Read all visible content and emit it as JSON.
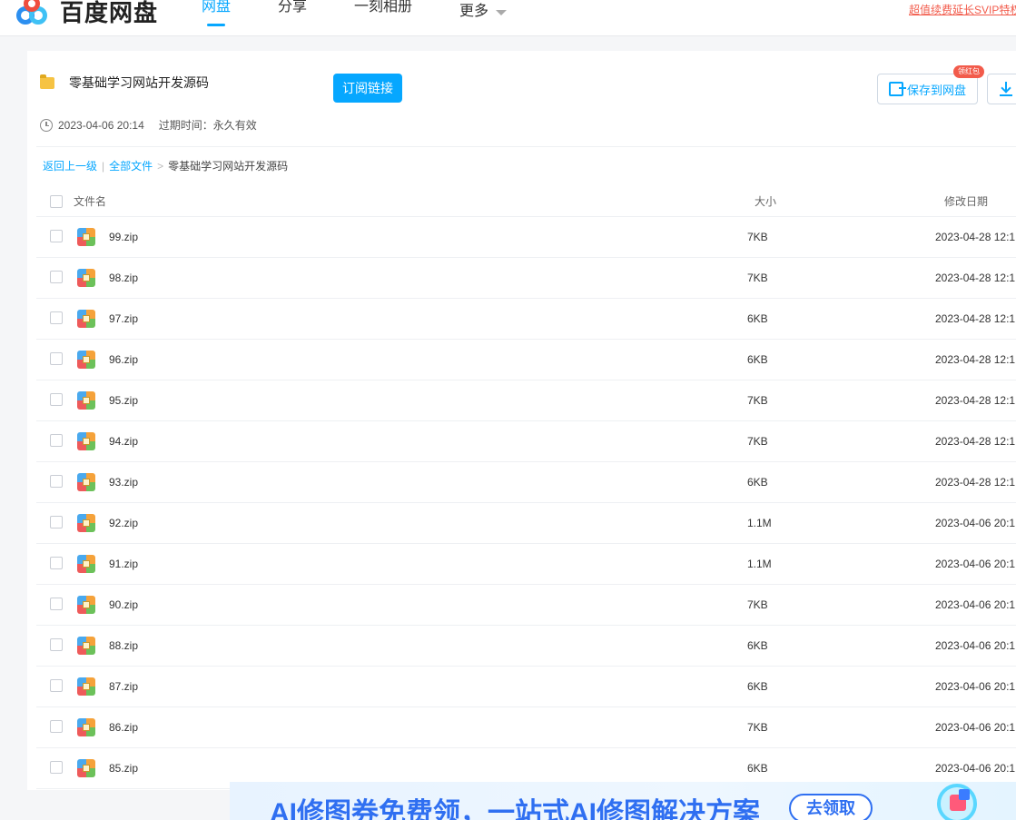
{
  "app": {
    "logo_text": "百度网盘"
  },
  "nav": {
    "items": [
      {
        "label": "网盘",
        "active": true
      },
      {
        "label": "分享",
        "active": false
      },
      {
        "label": "一刻相册",
        "active": false
      },
      {
        "label": "更多",
        "active": false
      }
    ],
    "promo": "超值续费延长SVIP特权"
  },
  "share": {
    "title": "零基础学习网站开发源码",
    "subscribe_label": "订阅链接",
    "save_label": "保存到网盘",
    "save_badge": "领红包",
    "created": "2023-04-06 20:14",
    "expire": "过期时间：永久有效"
  },
  "breadcrumb": {
    "back": "返回上一级",
    "sep": "|",
    "all": "全部文件",
    "arrow": ">",
    "current": "零基础学习网站开发源码"
  },
  "table": {
    "headers": {
      "name": "文件名",
      "size": "大小",
      "date": "修改日期"
    },
    "rows": [
      {
        "name": "99.zip",
        "size": "7KB",
        "date": "2023-04-28 12:1"
      },
      {
        "name": "98.zip",
        "size": "7KB",
        "date": "2023-04-28 12:1"
      },
      {
        "name": "97.zip",
        "size": "6KB",
        "date": "2023-04-28 12:1"
      },
      {
        "name": "96.zip",
        "size": "6KB",
        "date": "2023-04-28 12:1"
      },
      {
        "name": "95.zip",
        "size": "7KB",
        "date": "2023-04-28 12:1"
      },
      {
        "name": "94.zip",
        "size": "7KB",
        "date": "2023-04-28 12:1"
      },
      {
        "name": "93.zip",
        "size": "6KB",
        "date": "2023-04-28 12:1"
      },
      {
        "name": "92.zip",
        "size": "1.1M",
        "date": "2023-04-06 20:1"
      },
      {
        "name": "91.zip",
        "size": "1.1M",
        "date": "2023-04-06 20:1"
      },
      {
        "name": "90.zip",
        "size": "7KB",
        "date": "2023-04-06 20:1"
      },
      {
        "name": "88.zip",
        "size": "6KB",
        "date": "2023-04-06 20:1"
      },
      {
        "name": "87.zip",
        "size": "6KB",
        "date": "2023-04-06 20:1"
      },
      {
        "name": "86.zip",
        "size": "7KB",
        "date": "2023-04-06 20:1"
      },
      {
        "name": "85.zip",
        "size": "6KB",
        "date": "2023-04-06 20:1"
      }
    ]
  },
  "banner": {
    "text": "AI修图券免费领，一站式AI修图解决方案",
    "button": "去领取"
  },
  "colors": {
    "accent": "#06a7ff",
    "promo": "#f25b4b",
    "banner_text": "#2f6ff1"
  }
}
